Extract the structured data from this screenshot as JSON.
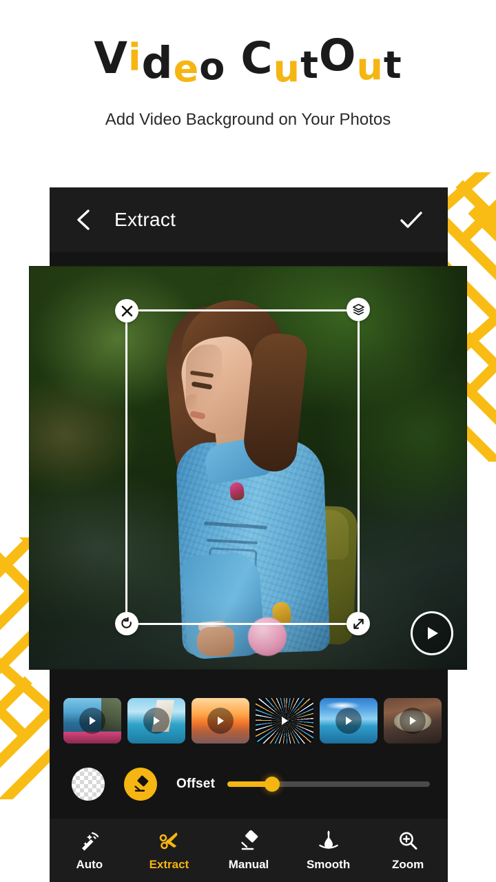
{
  "branding": {
    "title_letters": [
      {
        "ch": "V",
        "color": "black",
        "nudge": "n-up3"
      },
      {
        "ch": "i",
        "color": "yellow",
        "nudge": "n-up6"
      },
      {
        "ch": "d",
        "color": "black",
        "nudge": "n-dn3"
      },
      {
        "ch": "e",
        "color": "yellow",
        "nudge": "n-dn8"
      },
      {
        "ch": "o",
        "color": "black",
        "nudge": "n-dn5"
      },
      {
        "ch": "C",
        "color": "black",
        "nudge": "n-up3"
      },
      {
        "ch": "u",
        "color": "yellow",
        "nudge": "n-dn8"
      },
      {
        "ch": "t",
        "color": "black",
        "nudge": "n-dn3"
      },
      {
        "ch": "O",
        "color": "black",
        "nudge": "n-up6"
      },
      {
        "ch": "u",
        "color": "yellow",
        "nudge": "n-dn5"
      },
      {
        "ch": "t",
        "color": "black",
        "nudge": "n-dn3"
      }
    ],
    "title_plain": "Video CutOut",
    "subtitle": "Add Video Background on Your Photos",
    "accent_color": "#f5b512",
    "text_color": "#1b1b1b"
  },
  "app": {
    "header": {
      "back_icon": "chevron-left-icon",
      "title": "Extract",
      "done_icon": "check-icon"
    },
    "canvas": {
      "handles": [
        {
          "name": "close-handle",
          "icon": "close-icon",
          "pos": "top-left"
        },
        {
          "name": "layers-handle",
          "icon": "layers-icon",
          "pos": "top-right"
        },
        {
          "name": "rotate-handle",
          "icon": "rotate-icon",
          "pos": "bottom-left"
        },
        {
          "name": "resize-handle",
          "icon": "resize-diagonal-icon",
          "pos": "bottom-right"
        }
      ],
      "play_icon": "play-icon"
    },
    "thumbnails": [
      {
        "name": "thumb-boat-cliffs",
        "art": "art-boat",
        "play_icon": "play-icon"
      },
      {
        "name": "thumb-sailboat",
        "art": "art-sail",
        "play_icon": "play-icon"
      },
      {
        "name": "thumb-sunset",
        "art": "art-sunset",
        "play_icon": "play-icon"
      },
      {
        "name": "thumb-ferris-wheel",
        "art": "art-wheel",
        "play_icon": "play-icon"
      },
      {
        "name": "thumb-blue-sea",
        "art": "art-sea",
        "play_icon": "play-icon"
      },
      {
        "name": "thumb-city-aerial",
        "art": "art-city",
        "play_icon": "play-icon"
      }
    ],
    "offset_row": {
      "transparency_swatch": "transparent",
      "eraser_icon": "eraser-icon",
      "label": "Offset",
      "slider_percent": 22
    },
    "bottom_nav": [
      {
        "label": "Auto",
        "icon": "magic-wand-icon",
        "active": false
      },
      {
        "label": "Extract",
        "icon": "scissors-icon",
        "active": true
      },
      {
        "label": "Manual",
        "icon": "eraser-icon",
        "active": false
      },
      {
        "label": "Smooth",
        "icon": "droplet-icon",
        "active": false
      },
      {
        "label": "Zoom",
        "icon": "zoom-in-icon",
        "active": false
      }
    ]
  }
}
